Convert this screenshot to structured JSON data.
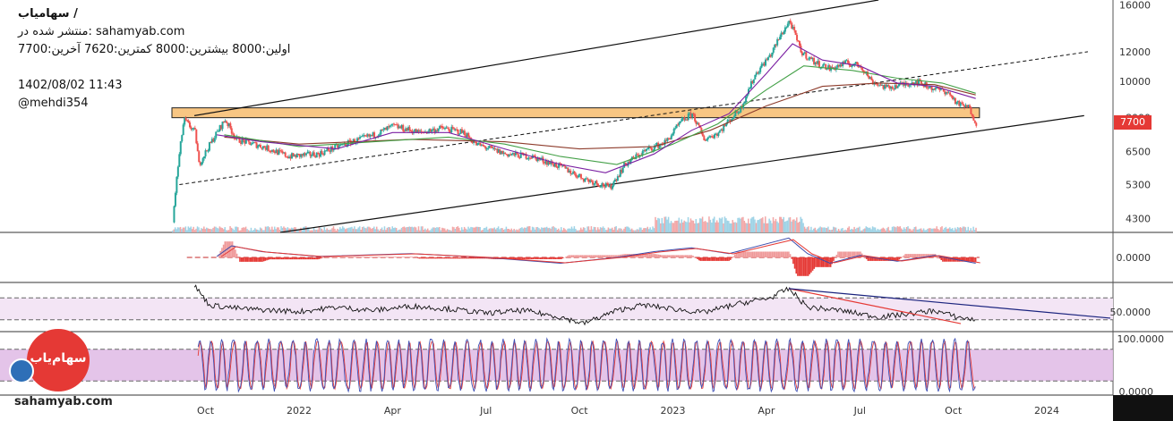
{
  "header": {
    "symbol_line": "سهامیاب /",
    "published_line": "منتشر شده در: sahamyab.com",
    "ohlc_line": "اولین:8000  بیشترین:8000  کمترین:7620  آخرین:7700",
    "datetime": "1402/08/02 11:43",
    "author": "@mehdi354"
  },
  "watermark": {
    "site": "sahamyab.com",
    "logo_text": "سهام‌یاب"
  },
  "colors": {
    "up": "#26a69a",
    "down": "#ef5350",
    "zone": "#f5b35a",
    "price_tag": "#e53935",
    "rsi_band": "#f3e5f5",
    "stoch_band": "#e1bee7",
    "ma_fast": "#7b1fa2",
    "ma_mid": "#43a047",
    "ma_slow": "#8d3b2b"
  },
  "chart_data": [
    {
      "type": "candlestick",
      "price_axis": [
        "16000",
        "12000",
        "10000",
        "8000",
        "6500",
        "5300",
        "4300"
      ],
      "price_axis_values": [
        16000,
        12000,
        10000,
        8000,
        6500,
        5300,
        4300
      ],
      "last_price_label": "7700",
      "ylim": [
        3950,
        16500
      ],
      "log_scale": true,
      "x_axis": [
        {
          "label": "Oct",
          "t": 2021.75
        },
        {
          "label": "2022",
          "t": 2022.0
        },
        {
          "label": "Apr",
          "t": 2022.25
        },
        {
          "label": "Jul",
          "t": 2022.5
        },
        {
          "label": "Oct",
          "t": 2022.75
        },
        {
          "label": "2023",
          "t": 2023.0
        },
        {
          "label": "Apr",
          "t": 2023.25
        },
        {
          "label": "Jul",
          "t": 2023.5
        },
        {
          "label": "Oct",
          "t": 2023.75
        },
        {
          "label": "2024",
          "t": 2024.0
        }
      ],
      "xlim": [
        2021.66,
        2024.17
      ],
      "price_path": [
        [
          2021.66,
          4200
        ],
        [
          2021.69,
          7900
        ],
        [
          2021.72,
          7300
        ],
        [
          2021.73,
          6000
        ],
        [
          2021.76,
          6800
        ],
        [
          2021.8,
          7900
        ],
        [
          2021.83,
          7000
        ],
        [
          2021.9,
          6700
        ],
        [
          2021.97,
          6300
        ],
        [
          2022.05,
          6400
        ],
        [
          2022.12,
          6800
        ],
        [
          2022.2,
          7200
        ],
        [
          2022.25,
          7600
        ],
        [
          2022.32,
          7300
        ],
        [
          2022.38,
          7500
        ],
        [
          2022.44,
          7300
        ],
        [
          2022.47,
          6800
        ],
        [
          2022.55,
          6400
        ],
        [
          2022.62,
          6300
        ],
        [
          2022.7,
          5900
        ],
        [
          2022.76,
          5500
        ],
        [
          2022.83,
          5200
        ],
        [
          2022.87,
          6000
        ],
        [
          2022.92,
          6500
        ],
        [
          2022.98,
          6900
        ],
        [
          2023.02,
          7800
        ],
        [
          2023.05,
          8200
        ],
        [
          2023.08,
          7000
        ],
        [
          2023.12,
          7300
        ],
        [
          2023.18,
          8500
        ],
        [
          2023.22,
          10500
        ],
        [
          2023.26,
          11800
        ],
        [
          2023.29,
          13500
        ],
        [
          2023.31,
          14500
        ],
        [
          2023.34,
          12000
        ],
        [
          2023.38,
          11200
        ],
        [
          2023.42,
          10800
        ],
        [
          2023.46,
          11200
        ],
        [
          2023.5,
          11000
        ],
        [
          2023.53,
          10000
        ],
        [
          2023.57,
          9600
        ],
        [
          2023.61,
          9800
        ],
        [
          2023.65,
          10000
        ],
        [
          2023.69,
          9600
        ],
        [
          2023.73,
          9400
        ],
        [
          2023.76,
          8700
        ],
        [
          2023.79,
          8500
        ],
        [
          2023.81,
          7700
        ]
      ],
      "resistance_zone": [
        8000,
        8500
      ],
      "channel_upper": [
        [
          2021.72,
          8100
        ],
        [
          2023.55,
          16500
        ]
      ],
      "channel_lower": [
        [
          2021.95,
          3950
        ],
        [
          2024.1,
          8100
        ]
      ],
      "channel_mid_dashed": [
        [
          2021.68,
          5300
        ],
        [
          2024.11,
          12000
        ]
      ],
      "ma_fast": [
        [
          2021.78,
          7200
        ],
        [
          2021.9,
          6900
        ],
        [
          2022.1,
          6600
        ],
        [
          2022.25,
          7300
        ],
        [
          2022.4,
          7300
        ],
        [
          2022.55,
          6600
        ],
        [
          2022.7,
          6000
        ],
        [
          2022.82,
          5700
        ],
        [
          2022.95,
          6400
        ],
        [
          2023.05,
          7400
        ],
        [
          2023.15,
          8200
        ],
        [
          2023.25,
          10500
        ],
        [
          2023.32,
          12600
        ],
        [
          2023.4,
          11400
        ],
        [
          2023.5,
          11000
        ],
        [
          2023.6,
          9900
        ],
        [
          2023.7,
          9700
        ],
        [
          2023.81,
          9000
        ]
      ],
      "ma_mid": [
        [
          2021.8,
          7200
        ],
        [
          2022.0,
          6700
        ],
        [
          2022.2,
          6900
        ],
        [
          2022.4,
          7100
        ],
        [
          2022.55,
          6800
        ],
        [
          2022.7,
          6300
        ],
        [
          2022.85,
          6000
        ],
        [
          2023.0,
          6800
        ],
        [
          2023.12,
          7700
        ],
        [
          2023.25,
          9500
        ],
        [
          2023.35,
          11000
        ],
        [
          2023.48,
          10700
        ],
        [
          2023.6,
          10200
        ],
        [
          2023.72,
          9900
        ],
        [
          2023.81,
          9300
        ]
      ],
      "ma_slow": [
        [
          2021.8,
          7100
        ],
        [
          2022.0,
          6800
        ],
        [
          2022.3,
          7000
        ],
        [
          2022.55,
          6900
        ],
        [
          2022.75,
          6600
        ],
        [
          2022.95,
          6700
        ],
        [
          2023.1,
          7400
        ],
        [
          2023.25,
          8600
        ],
        [
          2023.4,
          9700
        ],
        [
          2023.55,
          9900
        ],
        [
          2023.7,
          9800
        ],
        [
          2023.81,
          9200
        ]
      ]
    },
    {
      "type": "line",
      "name": "macd",
      "axis_label": "0.0000",
      "path": [
        [
          2021.78,
          0.05
        ],
        [
          2021.82,
          0.6
        ],
        [
          2021.9,
          0.3
        ],
        [
          2022.05,
          0.05
        ],
        [
          2022.3,
          0.2
        ],
        [
          2022.5,
          0.0
        ],
        [
          2022.7,
          -0.3
        ],
        [
          2022.85,
          0.0
        ],
        [
          2022.95,
          0.3
        ],
        [
          2023.05,
          0.5
        ],
        [
          2023.15,
          0.2
        ],
        [
          2023.25,
          0.7
        ],
        [
          2023.31,
          1.0
        ],
        [
          2023.36,
          0.2
        ],
        [
          2023.42,
          -0.3
        ],
        [
          2023.5,
          0.1
        ],
        [
          2023.6,
          -0.2
        ],
        [
          2023.7,
          0.1
        ],
        [
          2023.81,
          -0.3
        ]
      ],
      "ylim": [
        -1.2,
        1.2
      ]
    },
    {
      "type": "line",
      "name": "rsi",
      "axis_label": "50.0000",
      "ylim": [
        15,
        100
      ],
      "band": [
        35,
        75
      ],
      "path": [
        [
          2021.72,
          98
        ],
        [
          2021.76,
          62
        ],
        [
          2021.85,
          55
        ],
        [
          2022.0,
          50
        ],
        [
          2022.1,
          58
        ],
        [
          2022.2,
          52
        ],
        [
          2022.3,
          60
        ],
        [
          2022.4,
          55
        ],
        [
          2022.5,
          47
        ],
        [
          2022.6,
          52
        ],
        [
          2022.7,
          40
        ],
        [
          2022.76,
          28
        ],
        [
          2022.85,
          52
        ],
        [
          2022.92,
          62
        ],
        [
          2023.0,
          55
        ],
        [
          2023.08,
          48
        ],
        [
          2023.18,
          65
        ],
        [
          2023.26,
          75
        ],
        [
          2023.31,
          92
        ],
        [
          2023.36,
          58
        ],
        [
          2023.45,
          52
        ],
        [
          2023.55,
          40
        ],
        [
          2023.62,
          45
        ],
        [
          2023.7,
          52
        ],
        [
          2023.76,
          40
        ],
        [
          2023.81,
          35
        ]
      ],
      "trendline_red": [
        [
          2023.31,
          92
        ],
        [
          2023.77,
          28
        ]
      ],
      "trendline_blue": [
        [
          2023.31,
          92
        ],
        [
          2024.17,
          38
        ]
      ]
    },
    {
      "type": "line",
      "name": "stochastic",
      "axis_labels": [
        "100.0000",
        "0.0000"
      ],
      "ylim": [
        -5,
        110
      ],
      "band": [
        20,
        80
      ]
    }
  ]
}
